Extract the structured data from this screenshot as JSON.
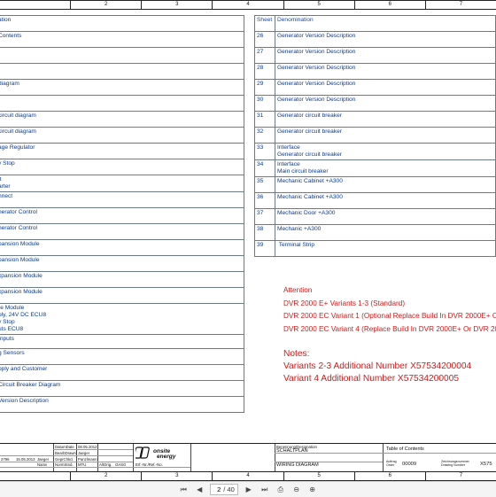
{
  "ruler": {
    "cols": [
      "",
      "2",
      "3",
      "4",
      "5",
      "6",
      "7"
    ]
  },
  "left_table": [
    {
      "text": "ation"
    },
    {
      "text": "Contents"
    },
    {
      "text": ""
    },
    {
      "text": ""
    },
    {
      "text": "diagram"
    },
    {
      "text": ""
    },
    {
      "text": "circuit diagram"
    },
    {
      "text": "circuit diagram"
    },
    {
      "text": "age Regulator"
    },
    {
      "text": "y Stop"
    },
    {
      "text": "it\narter"
    },
    {
      "text": "nnect"
    },
    {
      "text": "nerator Control"
    },
    {
      "text": "nerator Control"
    },
    {
      "text": "pansion Module"
    },
    {
      "text": "pansion Module"
    },
    {
      "text": "xpansion Module"
    },
    {
      "text": "xpansion Module"
    },
    {
      "text": "re Module\nply, 24V DC ECU8\ny Stop\nuts ECU8"
    },
    {
      "text": "Inputs"
    },
    {
      "text": "g Sensors"
    },
    {
      "text": "pply and Customer"
    },
    {
      "text": "Circuit Breaker Diagram"
    },
    {
      "text": "Version Description"
    }
  ],
  "right_table": {
    "header_sheet": "Sheet",
    "header_denomination": "Denomination",
    "rows": [
      {
        "sheet": "26",
        "text": "Generator Version Description"
      },
      {
        "sheet": "27",
        "text": "Generator Version Description"
      },
      {
        "sheet": "28",
        "text": "Generator Version Description"
      },
      {
        "sheet": "29",
        "text": "Generator Version Description"
      },
      {
        "sheet": "30",
        "text": "Generator Version Description"
      },
      {
        "sheet": "31",
        "text": "Generator circuit breaker"
      },
      {
        "sheet": "32",
        "text": "Generator circuit breaker"
      },
      {
        "sheet": "33",
        "text": "Interface\nGenerator circuit breaker"
      },
      {
        "sheet": "34",
        "text": "Interface\nMain circuit breaker"
      },
      {
        "sheet": "35",
        "text": "Mechanic Cabinet +A300"
      },
      {
        "sheet": "36",
        "text": "Mechanic Cabinet +A300"
      },
      {
        "sheet": "37",
        "text": "Mechanic Door +A300"
      },
      {
        "sheet": "38",
        "text": "Mechanic +A300"
      },
      {
        "sheet": "39",
        "text": " Terminal Strip"
      }
    ]
  },
  "attention": {
    "title": "Attention",
    "lines": [
      "DVR 2000 E+ Variants 1-3 (Standard)",
      "DVR 2000 EC Variant 1 (Optional Replace Build In DVR 2000E+ Or",
      "DVR 2000 EC Variant 4 (Replace Build In DVR 2000E+ Or DVR 20"
    ]
  },
  "notes": {
    "title": "Notes:",
    "lines": [
      "Variants 2-3 Additional Number  X57534200004",
      "Variant 4 Additional Number  X57534200005"
    ]
  },
  "title_block": {
    "rev_row1": [
      "",
      "DatumDate",
      "08.05.2012",
      ""
    ],
    "rev_row2": [
      "",
      "BearbDrawn",
      "Jaeger"
    ],
    "rev_a": "2796",
    "rev_date": "15.05.2013",
    "rev_name": "Jaeger",
    "rev_label_a": "Name",
    "rev_label_checked": "GeprChkd.",
    "rev_checked": "Panzlmann",
    "rev_label_std": "NormStnd.",
    "rev_std": "MTU",
    "alt_label": "AltOrig.",
    "src_label": "OASG",
    "erf_label": "Erf.-Nr./Ref.-No.",
    "logo_text": "onsite energy",
    "designation_label": "Benennung/Designation",
    "designation": "SCHALTPLAN",
    "designation_en": "WIRING DIAGRAM",
    "toc_label": "Table of Contents",
    "order_label": "Auftrag\nOrder",
    "order": "00009",
    "drawing_label": "Zeichnungsnummer\nDrawing Number",
    "drawing": "X575"
  },
  "toolbar": {
    "page_current": "2",
    "page_total": "/ 40",
    "icons": [
      "first-page-icon",
      "prev-page-icon",
      "next-page-icon",
      "last-page-icon",
      "print-icon",
      "zoom-out-icon",
      "zoom-in-icon"
    ]
  }
}
